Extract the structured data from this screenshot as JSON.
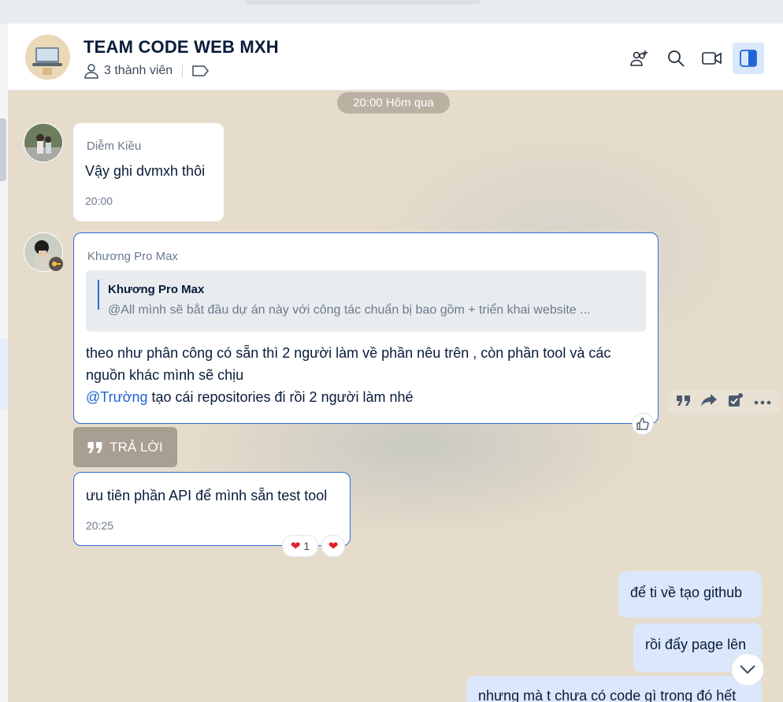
{
  "header": {
    "title": "TEAM CODE WEB MXH",
    "members": "3 thành viên",
    "accent": "#2f6ad6"
  },
  "date_divider": "20:00 Hôm qua",
  "messages": [
    {
      "sender": "Diễm Kiều",
      "text": "Vậy ghi dvmxh thôi",
      "time": "20:00"
    },
    {
      "sender": "Khương Pro Max",
      "quote": {
        "name": "Khương Pro Max",
        "text": "@All mình sẽ bắt đầu dự án này với công tác chuẩn bị bao gồm + triển khai website ..."
      },
      "line1": "theo như phân công có sẵn thì 2 người làm về phần nêu trên , còn phần tool và các",
      "line2": "nguồn khác mình sẽ chịu",
      "mention": "@Trường",
      "line3": " tạo cái repositories đi rồi 2 người làm nhé"
    },
    {
      "text": "ưu tiên phần API để mình sẵn test tool",
      "time": "20:25",
      "reaction_count": "1"
    }
  ],
  "reply_label": "TRẢ LỜI",
  "my_messages": [
    "để ti về tạo github",
    "rồi đẩy page lên",
    "nhưng mà t chưa có code gì trong đó hết"
  ]
}
